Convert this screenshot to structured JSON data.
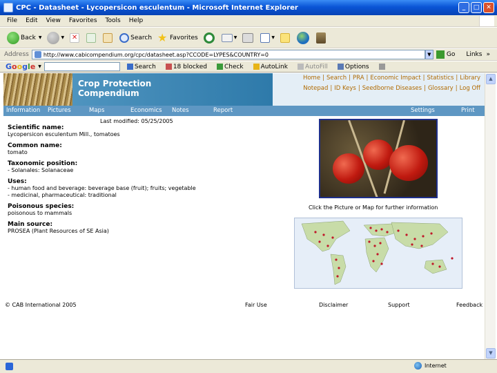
{
  "window": {
    "title": "CPC - Datasheet - Lycopersicon esculentum - Microsoft Internet Explorer",
    "minimize": "_",
    "maximize": "□",
    "close": "✕"
  },
  "menu": [
    "File",
    "Edit",
    "View",
    "Favorites",
    "Tools",
    "Help"
  ],
  "toolbar": {
    "back": "Back",
    "search": "Search",
    "favorites": "Favorites"
  },
  "address": {
    "label": "Address",
    "url": "http://www.cabicompendium.org/cpc/datasheet.asp?CCODE=LYPES&COUNTRY=0",
    "go": "Go",
    "links": "Links",
    "more": "»"
  },
  "google": {
    "logo": "Google",
    "search": "Search",
    "blocked": "18 blocked",
    "check": "Check",
    "autolink": "AutoLink",
    "autofill": "AutoFill",
    "options": "Options"
  },
  "banner": {
    "title_line1": "Crop Protection",
    "title_line2": "Compendium",
    "links_row1": [
      "Home",
      "|",
      "Search",
      "|",
      "PRA",
      "|",
      "Economic Impact",
      "|",
      "Statistics",
      "|",
      "Library"
    ],
    "links_row2": [
      "Notepad",
      "|",
      "ID Keys",
      "|",
      "Seedborne Diseases",
      "|",
      "Glossary",
      "|",
      "Log Off"
    ]
  },
  "tabs": [
    "Information",
    "Pictures",
    "Maps",
    "Economics",
    "Notes",
    "Report",
    "Settings",
    "Print"
  ],
  "last_modified": "Last modified: 05/25/2005",
  "sections": [
    {
      "heading": "Scientific name:",
      "lines": [
        "Lycopersicon esculentum Mill., tomatoes"
      ]
    },
    {
      "heading": "Common name:",
      "lines": [
        "tomato"
      ]
    },
    {
      "heading": "Taxonomic position:",
      "lines": [
        "- Solanales: Solanaceae"
      ]
    },
    {
      "heading": "Uses:",
      "lines": [
        "- human food and beverage: beverage base (fruit); fruits; vegetable",
        "- medicinal, pharmaceutical: traditional"
      ]
    },
    {
      "heading": "Poisonous species:",
      "lines": [
        "poisonous to mammals"
      ]
    },
    {
      "heading": "Main source:",
      "lines": [
        "PROSEA (Plant Resources of SE Asia)"
      ]
    }
  ],
  "caption": "Click the Picture or Map for further information",
  "footer": {
    "copyright": "© CAB International 2005",
    "fair_use": "Fair Use",
    "disclaimer": "Disclaimer",
    "support": "Support",
    "feedback": "Feedback"
  },
  "status": {
    "zone": "Internet"
  }
}
